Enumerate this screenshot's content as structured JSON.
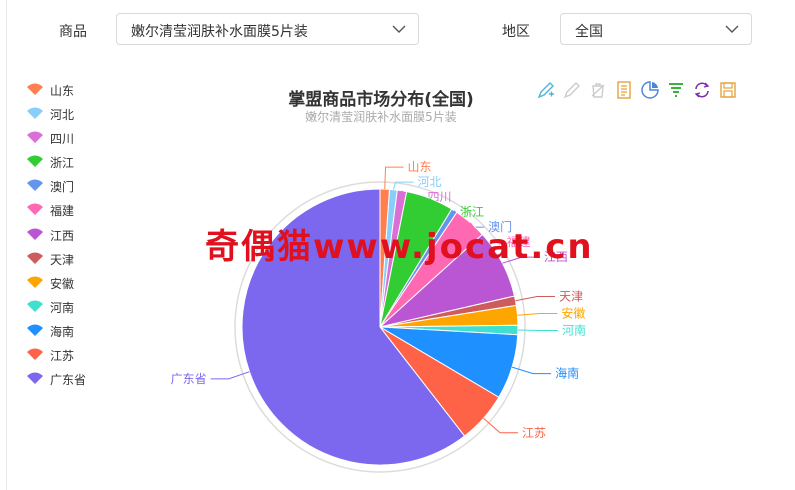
{
  "filters": {
    "product_label": "商品",
    "product_value": "嫩尔清莹润肤补水面膜5片装",
    "region_label": "地区",
    "region_value": "全国"
  },
  "toolbar": {
    "icons": [
      "mark-icon",
      "remove-mark-icon",
      "clear-mark-icon",
      "data-view-icon",
      "pie-type-icon",
      "funnel-type-icon",
      "restore-icon",
      "save-image-icon"
    ],
    "color": "#4eb5d6"
  },
  "watermark": "奇偶猫www.jocat.cn",
  "chart_data": {
    "type": "pie",
    "title": "掌盟商品市场分布(全国)",
    "subtitle": "嫩尔清莹润肤补水面膜5片装",
    "legend_position": "left",
    "slices": [
      {
        "name": "山东",
        "value": 1.1,
        "color": "#ff7f50"
      },
      {
        "name": "河北",
        "value": 0.9,
        "color": "#87cefa"
      },
      {
        "name": "四川",
        "value": 1.1,
        "color": "#da70d6"
      },
      {
        "name": "浙江",
        "value": 5.6,
        "color": "#32cd32"
      },
      {
        "name": "澳门",
        "value": 0.7,
        "color": "#6495ed"
      },
      {
        "name": "福建",
        "value": 3.9,
        "color": "#ff69b4"
      },
      {
        "name": "江西",
        "value": 8.1,
        "color": "#ba55d3"
      },
      {
        "name": "天津",
        "value": 1.1,
        "color": "#cd5c5c"
      },
      {
        "name": "安徽",
        "value": 2.3,
        "color": "#ffa500"
      },
      {
        "name": "河南",
        "value": 1.1,
        "color": "#40e0d0"
      },
      {
        "name": "海南",
        "value": 7.6,
        "color": "#1e90ff"
      },
      {
        "name": "江苏",
        "value": 6.0,
        "color": "#ff6347"
      },
      {
        "name": "广东省",
        "value": 60.5,
        "color": "#7b68ee"
      }
    ]
  }
}
